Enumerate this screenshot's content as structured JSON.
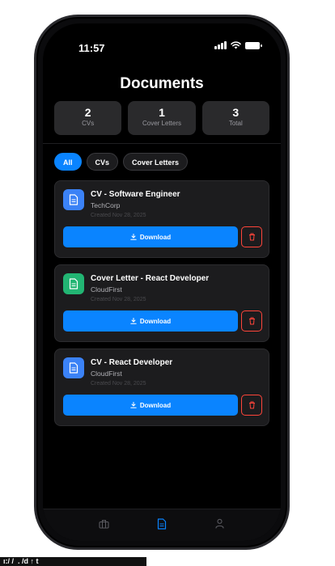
{
  "status_bar": {
    "time": "11:57"
  },
  "page": {
    "title": "Documents"
  },
  "stats": [
    {
      "value": "2",
      "label": "CVs"
    },
    {
      "value": "1",
      "label": "Cover Letters"
    },
    {
      "value": "3",
      "label": "Total"
    }
  ],
  "filters": [
    {
      "label": "All",
      "active": true
    },
    {
      "label": "CVs",
      "active": false
    },
    {
      "label": "Cover Letters",
      "active": false
    }
  ],
  "documents": [
    {
      "title": "CV - Software Engineer",
      "company": "TechCorp",
      "date": "Created Nov 28, 2025",
      "icon": "document-icon",
      "icon_color": "#3b82f6",
      "download_label": "Download"
    },
    {
      "title": "Cover Letter - React Developer",
      "company": "CloudFirst",
      "date": "Created Nov 28, 2025",
      "icon": "document-icon",
      "icon_color": "#22b573",
      "download_label": "Download"
    },
    {
      "title": "CV - React Developer",
      "company": "CloudFirst",
      "date": "Created Nov 28, 2025",
      "icon": "document-icon",
      "icon_color": "#3b82f6",
      "download_label": "Download"
    }
  ],
  "tabs": [
    {
      "icon": "briefcase-icon",
      "active": false
    },
    {
      "icon": "document-icon",
      "active": true
    },
    {
      "icon": "person-icon",
      "active": false
    }
  ],
  "colors": {
    "accent": "#0a84ff",
    "danger": "#ff453a",
    "background": "#000000",
    "card": "#1c1c1e"
  },
  "url_bar": {
    "text": "ı:/ / ⁣  .  /d  ↑  t"
  }
}
